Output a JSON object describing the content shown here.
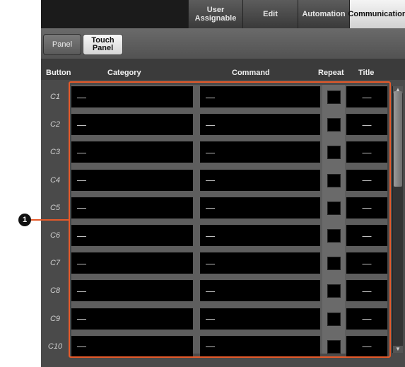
{
  "top_tabs": [
    {
      "label": "User\nAssignable",
      "active": false
    },
    {
      "label": "Edit",
      "active": false
    },
    {
      "label": "Automation",
      "active": false
    },
    {
      "label": "Communication",
      "active": true
    }
  ],
  "sub_tabs": [
    {
      "label": "Panel",
      "active": false
    },
    {
      "label": "Touch\nPanel",
      "active": true
    }
  ],
  "columns": {
    "button": "Button",
    "category": "Category",
    "command": "Command",
    "repeat": "Repeat",
    "title": "Title"
  },
  "rows": [
    {
      "button": "C1",
      "category": "—",
      "command": "—",
      "title": "—"
    },
    {
      "button": "C2",
      "category": "—",
      "command": "—",
      "title": "—"
    },
    {
      "button": "C3",
      "category": "—",
      "command": "—",
      "title": "—"
    },
    {
      "button": "C4",
      "category": "—",
      "command": "—",
      "title": "—"
    },
    {
      "button": "C5",
      "category": "—",
      "command": "—",
      "title": "—"
    },
    {
      "button": "C6",
      "category": "—",
      "command": "—",
      "title": "—"
    },
    {
      "button": "C7",
      "category": "—",
      "command": "—",
      "title": "—"
    },
    {
      "button": "C8",
      "category": "—",
      "command": "—",
      "title": "—"
    },
    {
      "button": "C9",
      "category": "—",
      "command": "—",
      "title": "—"
    },
    {
      "button": "C10",
      "category": "—",
      "command": "—",
      "title": "—"
    }
  ],
  "callout": {
    "number": "1"
  },
  "colors": {
    "highlight": "#e65a2a"
  }
}
